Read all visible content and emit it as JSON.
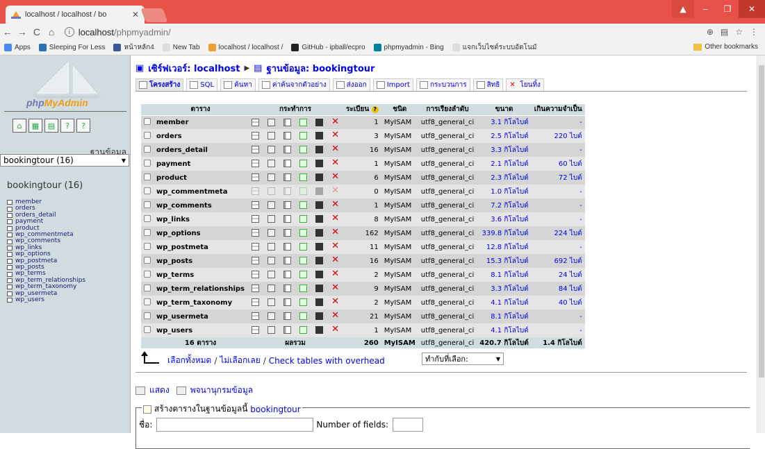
{
  "browser": {
    "tab_title": "localhost / localhost / bo",
    "url_host": "localhost",
    "url_path": "/phpmyadmin/",
    "bookmarks": [
      {
        "label": "Apps",
        "color": "#4a8af4"
      },
      {
        "label": "Sleeping For Less",
        "color": "#2c6fb7"
      },
      {
        "label": "หน้าหลัก4",
        "color": "#3b5998"
      },
      {
        "label": "New Tab",
        "color": "#dddddd"
      },
      {
        "label": "localhost / localhost /",
        "color": "#f0a030"
      },
      {
        "label": "GitHub - ipball/ecpro",
        "color": "#222222"
      },
      {
        "label": "phpmyadmin - Bing",
        "color": "#00809d"
      },
      {
        "label": "แจกเว็บไซต์ระบบอัตโนมั",
        "color": "#dddddd"
      }
    ],
    "other_bookmarks": "Other bookmarks"
  },
  "sidebar": {
    "logo_text_a": "php",
    "logo_text_b": "MyAdmin",
    "db_label": "ฐานข้อมูล",
    "db_select": "bookingtour (16)",
    "db_title": "bookingtour (16)",
    "tables": [
      "member",
      "orders",
      "orders_detail",
      "payment",
      "product",
      "wp_commentmeta",
      "wp_comments",
      "wp_links",
      "wp_options",
      "wp_postmeta",
      "wp_posts",
      "wp_terms",
      "wp_term_relationships",
      "wp_term_taxonomy",
      "wp_usermeta",
      "wp_users"
    ]
  },
  "breadcrumb": {
    "server": "เซิร์ฟเวอร์: localhost",
    "database": "ฐานข้อมูล: bookingtour"
  },
  "tabs": [
    "โครงสร้าง",
    "SQL",
    "ค้นหา",
    "ค่าค้นจากตัวอย่าง",
    "ส่งออก",
    "Import",
    "กระบวนการ",
    "สิทธิ",
    "โยนทิ้ง"
  ],
  "table": {
    "headers": [
      "ตาราง",
      "กระทำการ",
      "ระเบียน",
      "ชนิด",
      "การเรียงลำดับ",
      "ขนาด",
      "เกินความจำเป็น"
    ],
    "rows": [
      {
        "name": "member",
        "records": "1",
        "type": "MyISAM",
        "collation": "utf8_general_ci",
        "size": "3.1 กิโลไบต์",
        "overhead": "-",
        "empty": false
      },
      {
        "name": "orders",
        "records": "3",
        "type": "MyISAM",
        "collation": "utf8_general_ci",
        "size": "2.5 กิโลไบต์",
        "overhead": "220 ไบต์",
        "empty": false
      },
      {
        "name": "orders_detail",
        "records": "16",
        "type": "MyISAM",
        "collation": "utf8_general_ci",
        "size": "3.3 กิโลไบต์",
        "overhead": "-",
        "empty": false
      },
      {
        "name": "payment",
        "records": "1",
        "type": "MyISAM",
        "collation": "utf8_general_ci",
        "size": "2.1 กิโลไบต์",
        "overhead": "60 ไบต์",
        "empty": false
      },
      {
        "name": "product",
        "records": "6",
        "type": "MyISAM",
        "collation": "utf8_general_ci",
        "size": "2.3 กิโลไบต์",
        "overhead": "72 ไบต์",
        "empty": false
      },
      {
        "name": "wp_commentmeta",
        "records": "0",
        "type": "MyISAM",
        "collation": "utf8_general_ci",
        "size": "1.0 กิโลไบต์",
        "overhead": "-",
        "empty": true
      },
      {
        "name": "wp_comments",
        "records": "1",
        "type": "MyISAM",
        "collation": "utf8_general_ci",
        "size": "7.2 กิโลไบต์",
        "overhead": "-",
        "empty": false
      },
      {
        "name": "wp_links",
        "records": "8",
        "type": "MyISAM",
        "collation": "utf8_general_ci",
        "size": "3.6 กิโลไบต์",
        "overhead": "-",
        "empty": false
      },
      {
        "name": "wp_options",
        "records": "162",
        "type": "MyISAM",
        "collation": "utf8_general_ci",
        "size": "339.8 กิโลไบต์",
        "overhead": "224 ไบต์",
        "empty": false
      },
      {
        "name": "wp_postmeta",
        "records": "11",
        "type": "MyISAM",
        "collation": "utf8_general_ci",
        "size": "12.8 กิโลไบต์",
        "overhead": "-",
        "empty": false
      },
      {
        "name": "wp_posts",
        "records": "16",
        "type": "MyISAM",
        "collation": "utf8_general_ci",
        "size": "15.3 กิโลไบต์",
        "overhead": "692 ไบต์",
        "empty": false
      },
      {
        "name": "wp_terms",
        "records": "2",
        "type": "MyISAM",
        "collation": "utf8_general_ci",
        "size": "8.1 กิโลไบต์",
        "overhead": "24 ไบต์",
        "empty": false
      },
      {
        "name": "wp_term_relationships",
        "records": "9",
        "type": "MyISAM",
        "collation": "utf8_general_ci",
        "size": "3.3 กิโลไบต์",
        "overhead": "84 ไบต์",
        "empty": false
      },
      {
        "name": "wp_term_taxonomy",
        "records": "2",
        "type": "MyISAM",
        "collation": "utf8_general_ci",
        "size": "4.1 กิโลไบต์",
        "overhead": "40 ไบต์",
        "empty": false
      },
      {
        "name": "wp_usermeta",
        "records": "21",
        "type": "MyISAM",
        "collation": "utf8_general_ci",
        "size": "8.1 กิโลไบต์",
        "overhead": "-",
        "empty": false
      },
      {
        "name": "wp_users",
        "records": "1",
        "type": "MyISAM",
        "collation": "utf8_general_ci",
        "size": "4.1 กิโลไบต์",
        "overhead": "-",
        "empty": false
      }
    ],
    "summary": {
      "count": "16 ตาราง",
      "label": "ผลรวม",
      "records": "260",
      "type": "MyISAM",
      "collation": "utf8_general_ci",
      "size": "420.7 กิโลไบต์",
      "overhead": "1.4 กิโลไบต์"
    }
  },
  "select_all": "เลือกทั้งหมด",
  "deselect_all": "ไม่เลือกเลย",
  "check_overhead": "Check tables with overhead",
  "with_selected": "ทำกับที่เลือก:",
  "print_view": "แสดง",
  "data_dictionary": "พจนานุกรมข้อมูล",
  "create_table": {
    "legend": "สร้างตารางในฐานข้อมูลนี้",
    "db": "bookingtour",
    "name_label": "ชื่อ:",
    "fields_label": "Number of fields:"
  }
}
